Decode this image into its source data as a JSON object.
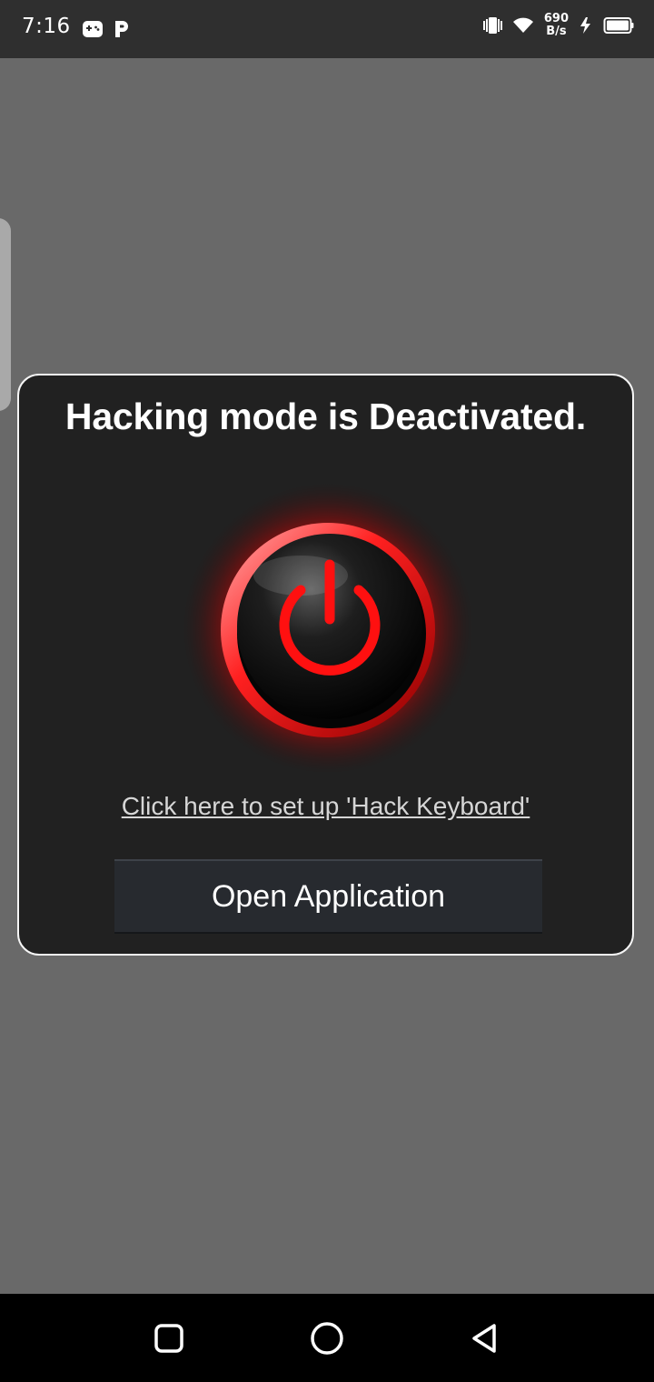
{
  "status_bar": {
    "time": "7:16",
    "left_icons": [
      "gamepad-icon",
      "parking-p-icon"
    ],
    "net_speed_value": "690",
    "net_speed_unit": "B/s",
    "right_icons": [
      "vibrate-icon",
      "wifi-icon",
      "charging-bolt-icon",
      "battery-icon"
    ]
  },
  "dialog": {
    "title": "Hacking mode is Deactivated.",
    "power_button_icon": "power-icon",
    "power_state": "off",
    "accent_color": "#ff1a1a",
    "setup_link": "Click here to set up 'Hack Keyboard'",
    "open_button_label": "Open Application"
  },
  "nav_bar": {
    "buttons": [
      "recents-square-icon",
      "home-circle-icon",
      "back-triangle-icon"
    ]
  }
}
